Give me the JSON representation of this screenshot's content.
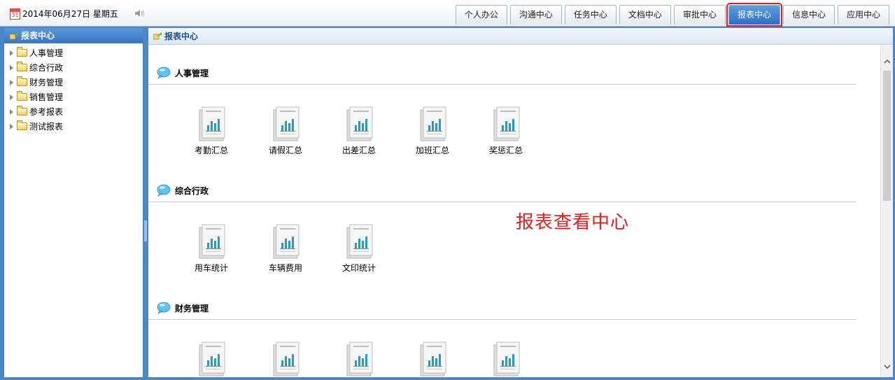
{
  "topbar": {
    "date_text": "2014年06月27日 星期五",
    "calendar_day": "31",
    "tabs": [
      {
        "label": "个人办公"
      },
      {
        "label": "沟通中心"
      },
      {
        "label": "任务中心"
      },
      {
        "label": "文档中心"
      },
      {
        "label": "审批中心"
      },
      {
        "label": "报表中心",
        "active": true
      },
      {
        "label": "信息中心"
      },
      {
        "label": "应用中心"
      }
    ]
  },
  "sidebar": {
    "title": "报表中心",
    "items": [
      {
        "label": "人事管理"
      },
      {
        "label": "综合行政"
      },
      {
        "label": "财务管理"
      },
      {
        "label": "销售管理"
      },
      {
        "label": "参考报表"
      },
      {
        "label": "测试报表"
      }
    ]
  },
  "main": {
    "title": "报表中心",
    "watermark": "报表查看中心",
    "sections": [
      {
        "title": "人事管理",
        "reports": [
          "考勤汇总",
          "请假汇总",
          "出差汇总",
          "加班汇总",
          "奖惩汇总"
        ]
      },
      {
        "title": "综合行政",
        "reports": [
          "用车统计",
          "车辆费用",
          "文印统计"
        ]
      },
      {
        "title": "财务管理",
        "reports": [
          "",
          "",
          "",
          "",
          ""
        ]
      }
    ]
  },
  "colors": {
    "accent": "#3777c2",
    "active_tab_outline": "#e02020",
    "watermark": "#e02020",
    "chart_bars": "#2a9bc0"
  }
}
